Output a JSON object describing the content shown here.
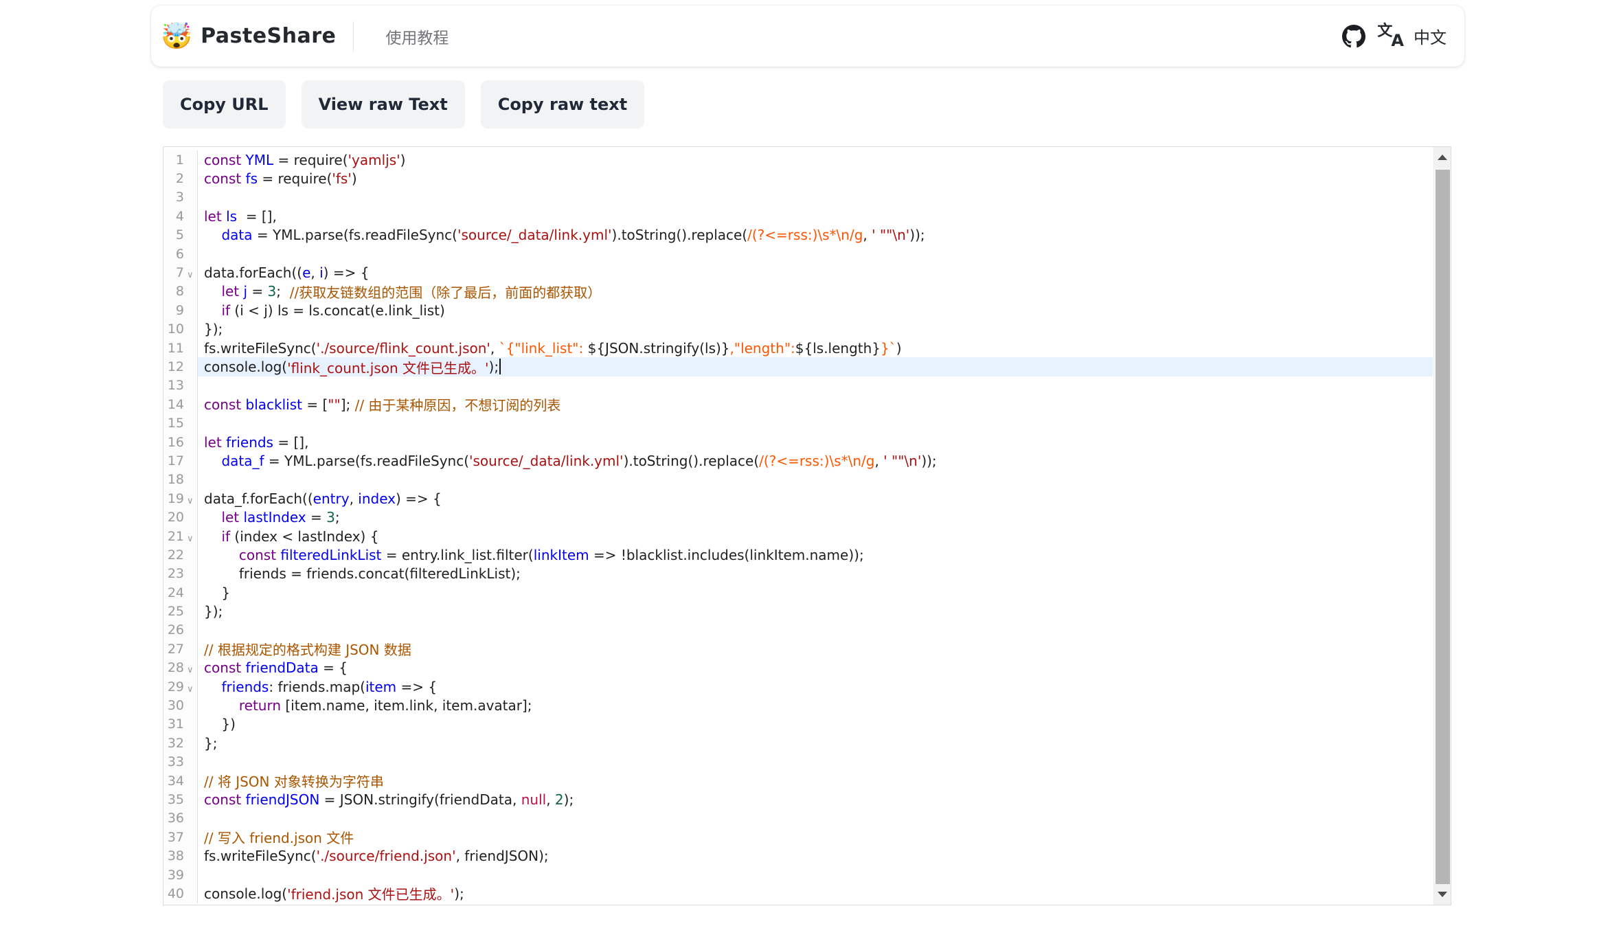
{
  "header": {
    "logo": "🤯",
    "title": "PasteShare",
    "tutorial": "使用教程",
    "translate_glyph_1": "文",
    "translate_glyph_2": "A",
    "language": "中文"
  },
  "toolbar": {
    "copy_url": "Copy URL",
    "view_raw": "View raw Text",
    "copy_raw": "Copy raw text"
  },
  "icons": {
    "fold": "∨"
  },
  "palette": {
    "keyword": "#770088",
    "def": "#0000ee",
    "string": "#aa1111",
    "string2": "#ff5500",
    "comment": "#aa5500",
    "number": "#116644",
    "atom": "#bb1144",
    "plain": "#1f1f1f",
    "line_number": "#999999",
    "active_line_bg": "#e8f2fe"
  },
  "editor": {
    "lines": [
      {
        "n": 1,
        "fold": false,
        "active": false,
        "tokens": [
          [
            "kw",
            "const"
          ],
          [
            "pl",
            " "
          ],
          [
            "df",
            "YML"
          ],
          [
            "pl",
            " = require("
          ],
          [
            "st",
            "'yamljs'"
          ],
          [
            "pl",
            ")"
          ]
        ]
      },
      {
        "n": 2,
        "fold": false,
        "active": false,
        "tokens": [
          [
            "kw",
            "const"
          ],
          [
            "pl",
            " "
          ],
          [
            "df",
            "fs"
          ],
          [
            "pl",
            " = require("
          ],
          [
            "st",
            "'fs'"
          ],
          [
            "pl",
            ")"
          ]
        ]
      },
      {
        "n": 3,
        "fold": false,
        "active": false,
        "tokens": []
      },
      {
        "n": 4,
        "fold": false,
        "active": false,
        "tokens": [
          [
            "kw",
            "let"
          ],
          [
            "pl",
            " "
          ],
          [
            "df",
            "ls"
          ],
          [
            "pl",
            "  = [],"
          ]
        ]
      },
      {
        "n": 5,
        "fold": false,
        "active": false,
        "tokens": [
          [
            "pl",
            "    "
          ],
          [
            "df",
            "data"
          ],
          [
            "pl",
            " = YML.parse(fs.readFileSync("
          ],
          [
            "st",
            "'source/_data/link.yml'"
          ],
          [
            "pl",
            ").toString().replace("
          ],
          [
            "s2",
            "/(?<=rss:)\\s*\\n/g"
          ],
          [
            "pl",
            ", "
          ],
          [
            "st",
            "' \"\"\\n'"
          ],
          [
            "pl",
            "));"
          ]
        ]
      },
      {
        "n": 6,
        "fold": false,
        "active": false,
        "tokens": []
      },
      {
        "n": 7,
        "fold": true,
        "active": false,
        "tokens": [
          [
            "pl",
            "data.forEach(("
          ],
          [
            "df",
            "e"
          ],
          [
            "pl",
            ", "
          ],
          [
            "df",
            "i"
          ],
          [
            "pl",
            ") => {"
          ]
        ]
      },
      {
        "n": 8,
        "fold": false,
        "active": false,
        "tokens": [
          [
            "pl",
            "    "
          ],
          [
            "kw",
            "let"
          ],
          [
            "pl",
            " "
          ],
          [
            "df",
            "j"
          ],
          [
            "pl",
            " = "
          ],
          [
            "nm",
            "3"
          ],
          [
            "pl",
            ";  "
          ],
          [
            "cm",
            "//获取友链数组的范围（除了最后，前面的都获取）"
          ]
        ]
      },
      {
        "n": 9,
        "fold": false,
        "active": false,
        "tokens": [
          [
            "pl",
            "    "
          ],
          [
            "kw",
            "if"
          ],
          [
            "pl",
            " (i < j) ls = ls.concat(e.link_list)"
          ]
        ]
      },
      {
        "n": 10,
        "fold": false,
        "active": false,
        "tokens": [
          [
            "pl",
            "});"
          ]
        ]
      },
      {
        "n": 11,
        "fold": false,
        "active": false,
        "tokens": [
          [
            "pl",
            "fs.writeFileSync("
          ],
          [
            "st",
            "'./source/flink_count.json'"
          ],
          [
            "pl",
            ", "
          ],
          [
            "s2",
            "`{\"link_list\": "
          ],
          [
            "pl",
            "${JSON.stringify(ls)}"
          ],
          [
            "s2",
            ",\"length\":"
          ],
          [
            "pl",
            "${ls.length}"
          ],
          [
            "s2",
            "}`"
          ],
          [
            "pl",
            ")"
          ]
        ]
      },
      {
        "n": 12,
        "fold": false,
        "active": true,
        "tokens": [
          [
            "pl",
            "console.log("
          ],
          [
            "st",
            "'flink_count.json 文件已生成。'"
          ],
          [
            "pl",
            ");"
          ]
        ]
      },
      {
        "n": 13,
        "fold": false,
        "active": false,
        "tokens": []
      },
      {
        "n": 14,
        "fold": false,
        "active": false,
        "tokens": [
          [
            "kw",
            "const"
          ],
          [
            "pl",
            " "
          ],
          [
            "df",
            "blacklist"
          ],
          [
            "pl",
            " = ["
          ],
          [
            "st",
            "\"\""
          ],
          [
            "pl",
            "]; "
          ],
          [
            "cm",
            "// 由于某种原因，不想订阅的列表"
          ]
        ]
      },
      {
        "n": 15,
        "fold": false,
        "active": false,
        "tokens": []
      },
      {
        "n": 16,
        "fold": false,
        "active": false,
        "tokens": [
          [
            "kw",
            "let"
          ],
          [
            "pl",
            " "
          ],
          [
            "df",
            "friends"
          ],
          [
            "pl",
            " = [],"
          ]
        ]
      },
      {
        "n": 17,
        "fold": false,
        "active": false,
        "tokens": [
          [
            "pl",
            "    "
          ],
          [
            "df",
            "data_f"
          ],
          [
            "pl",
            " = YML.parse(fs.readFileSync("
          ],
          [
            "st",
            "'source/_data/link.yml'"
          ],
          [
            "pl",
            ").toString().replace("
          ],
          [
            "s2",
            "/(?<=rss:)\\s*\\n/g"
          ],
          [
            "pl",
            ", "
          ],
          [
            "st",
            "' \"\"\\n'"
          ],
          [
            "pl",
            "));"
          ]
        ]
      },
      {
        "n": 18,
        "fold": false,
        "active": false,
        "tokens": []
      },
      {
        "n": 19,
        "fold": true,
        "active": false,
        "tokens": [
          [
            "pl",
            "data_f.forEach(("
          ],
          [
            "df",
            "entry"
          ],
          [
            "pl",
            ", "
          ],
          [
            "df",
            "index"
          ],
          [
            "pl",
            ") => {"
          ]
        ]
      },
      {
        "n": 20,
        "fold": false,
        "active": false,
        "tokens": [
          [
            "pl",
            "    "
          ],
          [
            "kw",
            "let"
          ],
          [
            "pl",
            " "
          ],
          [
            "df",
            "lastIndex"
          ],
          [
            "pl",
            " = "
          ],
          [
            "nm",
            "3"
          ],
          [
            "pl",
            ";"
          ]
        ]
      },
      {
        "n": 21,
        "fold": true,
        "active": false,
        "tokens": [
          [
            "pl",
            "    "
          ],
          [
            "kw",
            "if"
          ],
          [
            "pl",
            " (index < lastIndex) {"
          ]
        ]
      },
      {
        "n": 22,
        "fold": false,
        "active": false,
        "tokens": [
          [
            "pl",
            "        "
          ],
          [
            "kw",
            "const"
          ],
          [
            "pl",
            " "
          ],
          [
            "df",
            "filteredLinkList"
          ],
          [
            "pl",
            " = entry.link_list.filter("
          ],
          [
            "df",
            "linkItem"
          ],
          [
            "pl",
            " => !blacklist.includes(linkItem.name));"
          ]
        ]
      },
      {
        "n": 23,
        "fold": false,
        "active": false,
        "tokens": [
          [
            "pl",
            "        friends = friends.concat(filteredLinkList);"
          ]
        ]
      },
      {
        "n": 24,
        "fold": false,
        "active": false,
        "tokens": [
          [
            "pl",
            "    }"
          ]
        ]
      },
      {
        "n": 25,
        "fold": false,
        "active": false,
        "tokens": [
          [
            "pl",
            "});"
          ]
        ]
      },
      {
        "n": 26,
        "fold": false,
        "active": false,
        "tokens": []
      },
      {
        "n": 27,
        "fold": false,
        "active": false,
        "tokens": [
          [
            "cm",
            "// 根据规定的格式构建 JSON 数据"
          ]
        ]
      },
      {
        "n": 28,
        "fold": true,
        "active": false,
        "tokens": [
          [
            "kw",
            "const"
          ],
          [
            "pl",
            " "
          ],
          [
            "df",
            "friendData"
          ],
          [
            "pl",
            " = {"
          ]
        ]
      },
      {
        "n": 29,
        "fold": true,
        "active": false,
        "tokens": [
          [
            "pl",
            "    "
          ],
          [
            "df",
            "friends"
          ],
          [
            "pl",
            ": friends.map("
          ],
          [
            "df",
            "item"
          ],
          [
            "pl",
            " => {"
          ]
        ]
      },
      {
        "n": 30,
        "fold": false,
        "active": false,
        "tokens": [
          [
            "pl",
            "        "
          ],
          [
            "kw",
            "return"
          ],
          [
            "pl",
            " [item.name, item.link, item.avatar];"
          ]
        ]
      },
      {
        "n": 31,
        "fold": false,
        "active": false,
        "tokens": [
          [
            "pl",
            "    })"
          ]
        ]
      },
      {
        "n": 32,
        "fold": false,
        "active": false,
        "tokens": [
          [
            "pl",
            "};"
          ]
        ]
      },
      {
        "n": 33,
        "fold": false,
        "active": false,
        "tokens": []
      },
      {
        "n": 34,
        "fold": false,
        "active": false,
        "tokens": [
          [
            "cm",
            "// 将 JSON 对象转换为字符串"
          ]
        ]
      },
      {
        "n": 35,
        "fold": false,
        "active": false,
        "tokens": [
          [
            "kw",
            "const"
          ],
          [
            "pl",
            " "
          ],
          [
            "df",
            "friendJSON"
          ],
          [
            "pl",
            " = JSON.stringify(friendData, "
          ],
          [
            "at",
            "null"
          ],
          [
            "pl",
            ", "
          ],
          [
            "nm",
            "2"
          ],
          [
            "pl",
            ");"
          ]
        ]
      },
      {
        "n": 36,
        "fold": false,
        "active": false,
        "tokens": []
      },
      {
        "n": 37,
        "fold": false,
        "active": false,
        "tokens": [
          [
            "cm",
            "// 写入 friend.json 文件"
          ]
        ]
      },
      {
        "n": 38,
        "fold": false,
        "active": false,
        "tokens": [
          [
            "pl",
            "fs.writeFileSync("
          ],
          [
            "st",
            "'./source/friend.json'"
          ],
          [
            "pl",
            ", friendJSON);"
          ]
        ]
      },
      {
        "n": 39,
        "fold": false,
        "active": false,
        "tokens": []
      },
      {
        "n": 40,
        "fold": false,
        "active": false,
        "tokens": [
          [
            "pl",
            "console.log("
          ],
          [
            "st",
            "'friend.json 文件已生成。'"
          ],
          [
            "pl",
            ");"
          ]
        ]
      }
    ]
  }
}
